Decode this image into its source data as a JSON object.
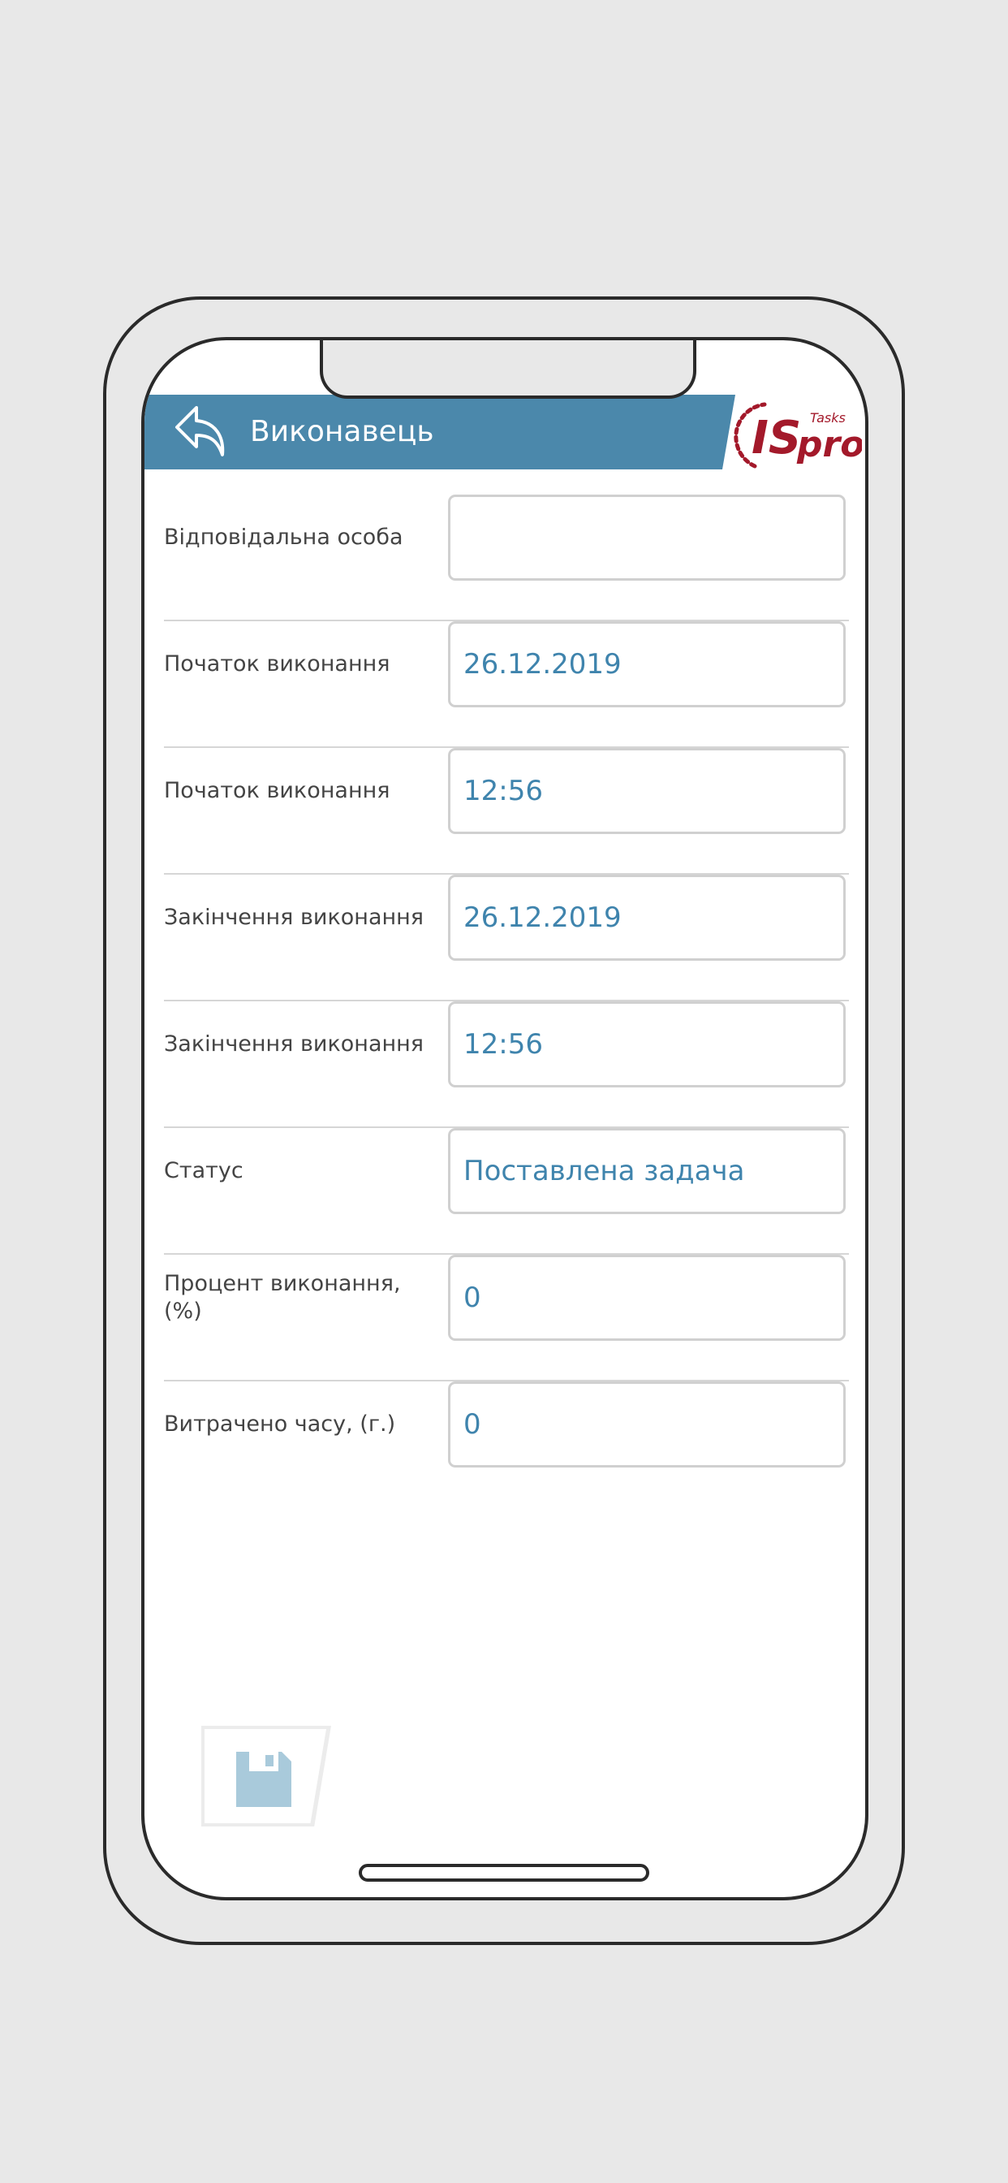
{
  "header": {
    "title": "Виконавець",
    "logo_text_main": "ISpro",
    "logo_text_sub": "Tasks",
    "bar_color": "#4b88ab",
    "logo_color": "#a3192a"
  },
  "form": {
    "rows": [
      {
        "label": "Відповідальна особа",
        "value": ""
      },
      {
        "label": "Початок виконання",
        "value": "26.12.2019"
      },
      {
        "label": "Початок виконання",
        "value": "12:56"
      },
      {
        "label": "Закінчення виконання",
        "value": "26.12.2019"
      },
      {
        "label": "Закінчення виконання",
        "value": "12:56"
      },
      {
        "label": "Статус",
        "value": "Поставлена задача"
      },
      {
        "label": "Процент виконання, (%)",
        "value": "0"
      },
      {
        "label": "Витрачено часу, (г.)",
        "value": "0"
      }
    ]
  },
  "icons": {
    "back": "back-arrow-icon",
    "save": "save-icon"
  }
}
